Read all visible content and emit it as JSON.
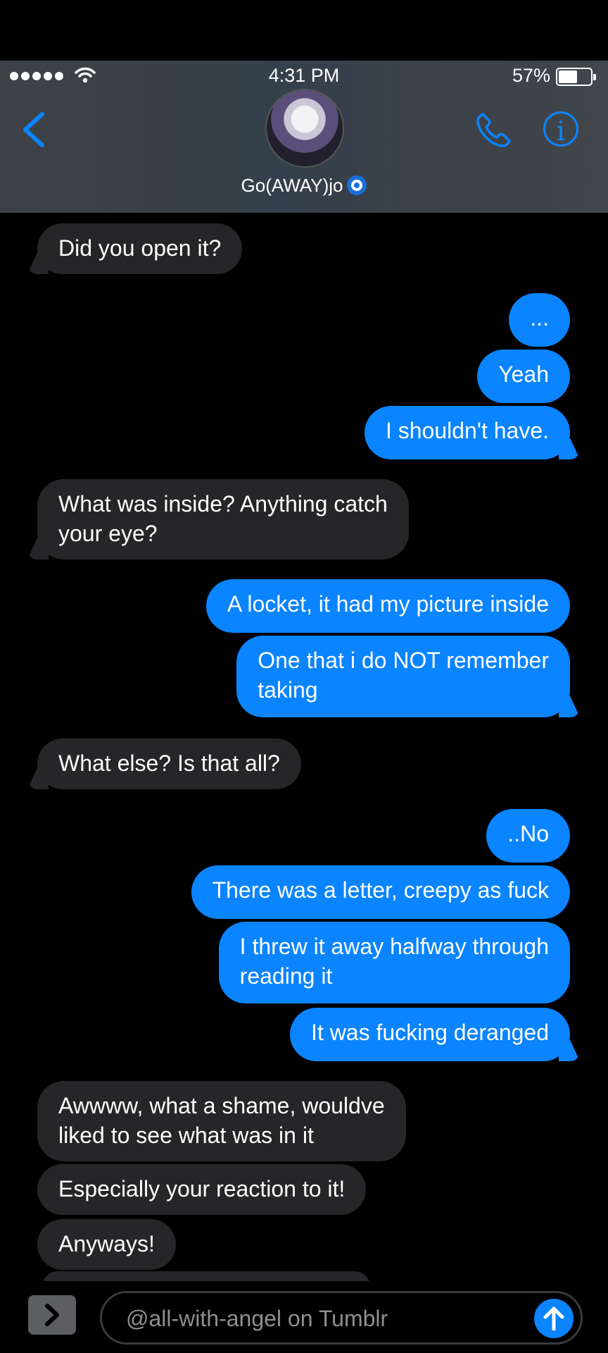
{
  "status_bar": {
    "time": "4:31 PM",
    "battery": "57%"
  },
  "header": {
    "contact_name": "Go(AWAY)jo"
  },
  "messages": [
    {
      "from": "them",
      "text": "Did you open it?"
    },
    {
      "from": "me",
      "text": "..."
    },
    {
      "from": "me",
      "text": "Yeah"
    },
    {
      "from": "me",
      "text": "I shouldn't have."
    },
    {
      "from": "them",
      "lines": [
        "What was inside? Anything catch",
        "your eye?"
      ]
    },
    {
      "from": "me",
      "text": "A locket, it had my picture inside"
    },
    {
      "from": "me",
      "lines": [
        "One that i do NOT remember",
        "taking"
      ]
    },
    {
      "from": "them",
      "text": "What else? Is that all?"
    },
    {
      "from": "me",
      "text": "..No"
    },
    {
      "from": "me",
      "text": "There was a letter, creepy as fuck"
    },
    {
      "from": "me",
      "lines": [
        "I threw it away halfway through",
        "reading it"
      ]
    },
    {
      "from": "me",
      "text": "It was fucking deranged"
    },
    {
      "from": "them",
      "lines": [
        "Awwww, what a shame, wouldve",
        "liked to see what was in it"
      ]
    },
    {
      "from": "them",
      "text": "Especially your reaction to it!"
    },
    {
      "from": "them",
      "text": "Anyways!"
    }
  ],
  "composer": {
    "placeholder": "@all-with-angel on Tumblr"
  },
  "colors": {
    "accent": "#0a84ff",
    "incoming_bubble": "#262629",
    "background": "#000000"
  }
}
